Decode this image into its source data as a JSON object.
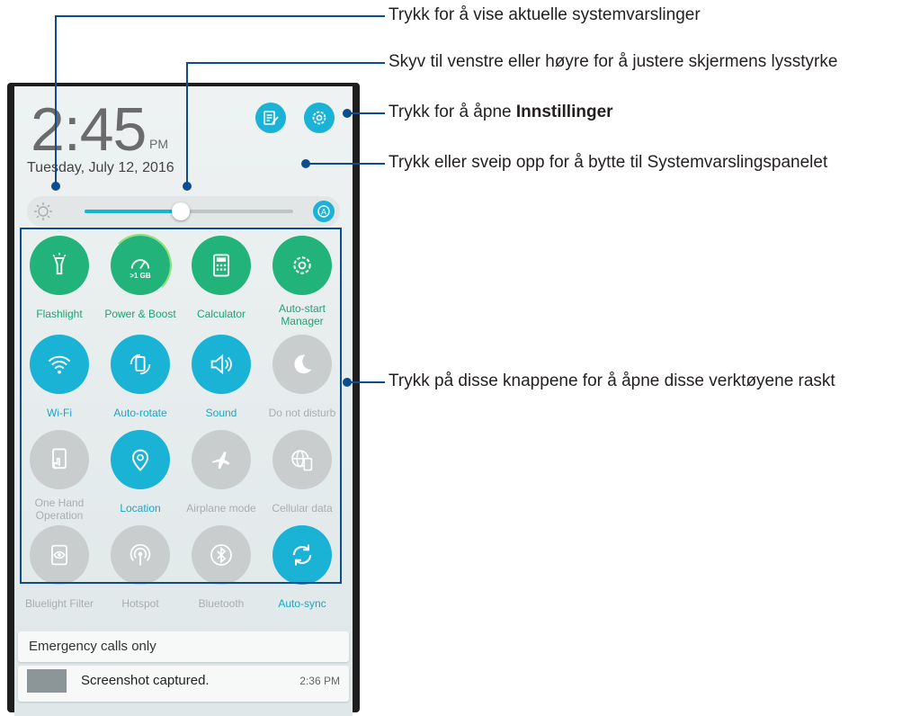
{
  "status": {
    "time": "2:45",
    "ampm": "PM",
    "date": "Tuesday, July 12, 2016"
  },
  "header_buttons": {
    "notes_icon": "notes-edit-icon",
    "settings_icon": "gear-icon"
  },
  "brightness": {
    "level_percent": 46,
    "auto_icon": "auto-brightness-icon"
  },
  "quick_settings": [
    {
      "label": "Flashlight",
      "icon": "flashlight-icon",
      "state": "on",
      "color": "#22b37a"
    },
    {
      "label": "Power & Boost",
      "icon": "boost-gauge-icon",
      "state": "on",
      "color": "#22b37a",
      "badge": ">1 GB"
    },
    {
      "label": "Calculator",
      "icon": "calculator-icon",
      "state": "on",
      "color": "#22b37a"
    },
    {
      "label": "Auto-start\nManager",
      "icon": "gear-icon",
      "state": "on",
      "color": "#22b37a"
    },
    {
      "label": "Wi-Fi",
      "icon": "wifi-icon",
      "state": "on",
      "color": "#1ab3d6"
    },
    {
      "label": "Auto-rotate",
      "icon": "rotate-icon",
      "state": "on",
      "color": "#1ab3d6"
    },
    {
      "label": "Sound",
      "icon": "speaker-icon",
      "state": "on",
      "color": "#1ab3d6"
    },
    {
      "label": "Do not disturb",
      "icon": "moon-icon",
      "state": "off",
      "color": "#c9cdce"
    },
    {
      "label": "One Hand\nOperation",
      "icon": "one-hand-icon",
      "state": "off",
      "color": "#c9cdce"
    },
    {
      "label": "Location",
      "icon": "location-pin-icon",
      "state": "on",
      "color": "#1ab3d6"
    },
    {
      "label": "Airplane mode",
      "icon": "airplane-icon",
      "state": "off",
      "color": "#c9cdce"
    },
    {
      "label": "Cellular data",
      "icon": "globe-phone-icon",
      "state": "off",
      "color": "#c9cdce"
    },
    {
      "label": "Bluelight Filter",
      "icon": "eye-icon",
      "state": "off",
      "color": "#c9cdce"
    },
    {
      "label": "Hotspot",
      "icon": "hotspot-icon",
      "state": "off",
      "color": "#c9cdce"
    },
    {
      "label": "Bluetooth",
      "icon": "bluetooth-icon",
      "state": "off",
      "color": "#c9cdce"
    },
    {
      "label": "Auto-sync",
      "icon": "sync-icon",
      "state": "on",
      "color": "#1ab3d6"
    }
  ],
  "notifications": {
    "emergency": "Emergency calls only",
    "screenshot_title": "Screenshot captured.",
    "screenshot_time": "2:36 PM"
  },
  "callouts": {
    "c1": "Trykk for å vise aktuelle systemvarslinger",
    "c2": "Skyv til venstre eller høyre for å justere skjermens lysstyrke",
    "c3_prefix": "Trykk for å åpne ",
    "c3_bold": "Innstillinger",
    "c4": "Trykk eller sveip opp for å bytte til Systemvarslingspanelet",
    "c5": "Trykk på disse knappene for å åpne disse verktøyene raskt"
  },
  "colors": {
    "accent_blue": "#1ab3d6",
    "accent_green": "#22b37a",
    "callout_line": "#0b4d8e"
  }
}
